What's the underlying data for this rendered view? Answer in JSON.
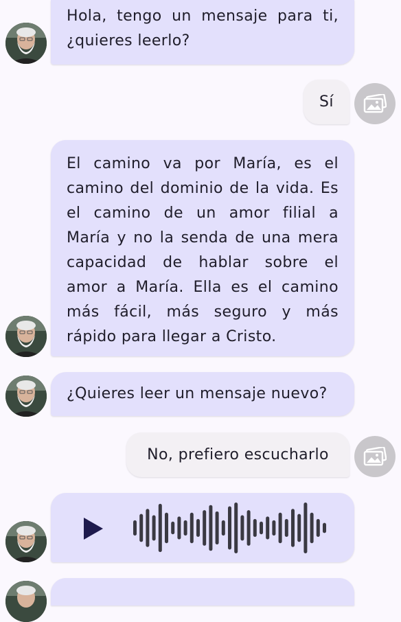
{
  "messages": [
    {
      "sender": "bot",
      "text": "Hola, tengo un mensaje para ti, ¿quieres leerlo?"
    },
    {
      "sender": "user",
      "text": "Sí"
    },
    {
      "sender": "bot",
      "text": "El camino va por María, es el camino del dominio de la vida. Es el camino de un amor filial a María y no la senda de una mera capacidad de hablar sobre el amor a María. Ella es el camino más fácil, más seguro y más rápido para llegar a Cristo."
    },
    {
      "sender": "bot",
      "text": "¿Quieres leer un mensaje nuevo?"
    },
    {
      "sender": "user",
      "text": "No, prefiero escucharlo"
    },
    {
      "sender": "bot",
      "type": "audio"
    }
  ],
  "text_lines": {
    "m0": [
      "Hola, tengo un mensaje para ti,",
      "¿quieres leerlo?"
    ],
    "m2": [
      "El camino va por María, es el",
      "camino del dominio de la vida. Es",
      "el camino de un amor filial a",
      "María y no la senda de una mera",
      "capacidad de hablar sobre el",
      "amor a María. Ella es el camino",
      "más fácil, más seguro y más",
      "rápido para llegar a Cristo."
    ]
  },
  "audio": {
    "waveform_levels": [
      0.3,
      0.55,
      0.75,
      0.5,
      0.95,
      0.6,
      0.25,
      0.45,
      0.3,
      0.6,
      0.35,
      0.7,
      0.9,
      0.65,
      0.3,
      0.85,
      1.0,
      0.5,
      0.7,
      0.35,
      0.25,
      0.45,
      0.3,
      0.6,
      0.35,
      0.75,
      0.55,
      1.0,
      0.6,
      0.35,
      0.2
    ]
  },
  "colors": {
    "bot_bubble": "#E3E0FC",
    "user_bubble": "#F3F0F4",
    "background": "#FBF8FE",
    "play": "#1E1A4D",
    "wave": "#3A3942",
    "user_avatar": "#C9C7CB"
  },
  "icons": {
    "bot_avatar": "avatar-photo",
    "user_avatar": "image-placeholder-icon"
  }
}
